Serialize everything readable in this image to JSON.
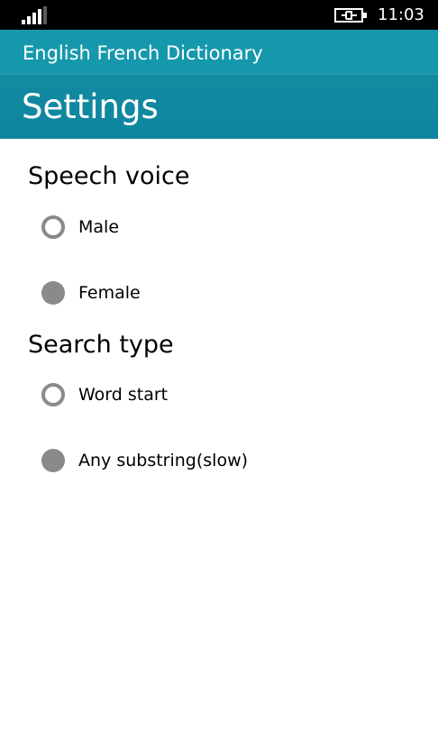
{
  "status_bar": {
    "time": "11:03",
    "signal_icon": "signal-strength-icon",
    "battery_icon": "battery-charging-icon"
  },
  "header": {
    "app_title": "English French Dictionary",
    "page_title": "Settings",
    "accent_color": "#1698ac"
  },
  "speech_voice": {
    "heading": "Speech voice",
    "options": [
      {
        "label": "Male",
        "selected": false
      },
      {
        "label": "Female",
        "selected": true
      }
    ]
  },
  "search_type": {
    "heading": "Search type",
    "options": [
      {
        "label": "Word start",
        "selected": false
      },
      {
        "label": "Any substring(slow)",
        "selected": true
      }
    ]
  }
}
